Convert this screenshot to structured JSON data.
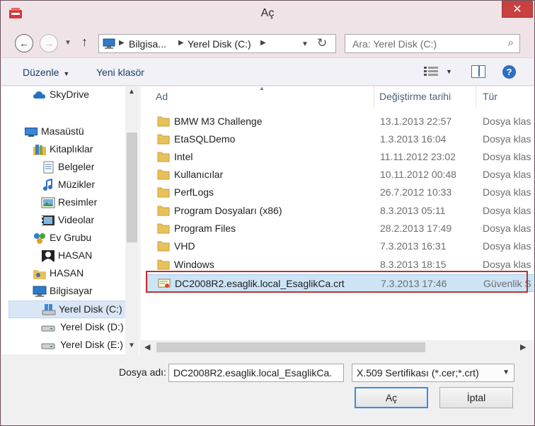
{
  "window": {
    "title": "Aç",
    "close_label": "✕"
  },
  "nav": {
    "address_segments": [
      "Bilgisa...",
      "Yerel Disk (C:)"
    ],
    "search_placeholder": "Ara: Yerel Disk (C:)"
  },
  "toolbar": {
    "organize_label": "Düzenle",
    "new_folder_label": "Yeni klasör"
  },
  "navpane": {
    "items": [
      {
        "label": "SkyDrive",
        "icon": "cloud-icon"
      },
      {
        "label": "Masaüstü",
        "icon": "desktop-icon"
      },
      {
        "label": "Kitaplıklar",
        "icon": "libraries-icon"
      },
      {
        "label": "Belgeler",
        "icon": "documents-icon"
      },
      {
        "label": "Müzikler",
        "icon": "music-icon"
      },
      {
        "label": "Resimler",
        "icon": "pictures-icon"
      },
      {
        "label": "Videolar",
        "icon": "videos-icon"
      },
      {
        "label": "Ev Grubu",
        "icon": "homegroup-icon"
      },
      {
        "label": "HASAN",
        "icon": "user-icon"
      },
      {
        "label": "HASAN",
        "icon": "user-folder-icon"
      },
      {
        "label": "Bilgisayar",
        "icon": "computer-icon"
      },
      {
        "label": "Yerel Disk (C:)",
        "icon": "system-drive-icon",
        "selected": true
      },
      {
        "label": "Yerel Disk (D:)",
        "icon": "drive-icon"
      },
      {
        "label": "Yerel Disk (E:)",
        "icon": "drive-icon"
      }
    ]
  },
  "filelist": {
    "columns": [
      "Ad",
      "Değiştirme tarihi",
      "Tür"
    ],
    "rows": [
      {
        "name": "BMW M3 Challenge",
        "date": "13.1.2013 22:57",
        "type": "Dosya klas",
        "icon": "folder-icon"
      },
      {
        "name": "EtaSQLDemo",
        "date": "1.3.2013 16:04",
        "type": "Dosya klas",
        "icon": "folder-icon"
      },
      {
        "name": "Intel",
        "date": "11.11.2012 23:02",
        "type": "Dosya klas",
        "icon": "folder-icon"
      },
      {
        "name": "Kullanıcılar",
        "date": "10.11.2012 00:48",
        "type": "Dosya klas",
        "icon": "folder-icon"
      },
      {
        "name": "PerfLogs",
        "date": "26.7.2012 10:33",
        "type": "Dosya klas",
        "icon": "folder-icon"
      },
      {
        "name": "Program Dosyaları (x86)",
        "date": "8.3.2013 05:11",
        "type": "Dosya klas",
        "icon": "folder-icon"
      },
      {
        "name": "Program Files",
        "date": "28.2.2013 17:49",
        "type": "Dosya klas",
        "icon": "folder-icon"
      },
      {
        "name": "VHD",
        "date": "7.3.2013 16:31",
        "type": "Dosya klas",
        "icon": "folder-icon"
      },
      {
        "name": "Windows",
        "date": "8.3.2013 18:15",
        "type": "Dosya klas",
        "icon": "folder-icon"
      },
      {
        "name": "DC2008R2.esaglik.local_EsaglikCa.crt",
        "date": "7.3.2013 17:46",
        "type": "Güvenlik S",
        "icon": "certificate-icon",
        "selected": true
      }
    ]
  },
  "bottom": {
    "filename_label": "Dosya adı:",
    "filename_value": "DC2008R2.esaglik.local_EsaglikCa.",
    "filter_value": "X.509 Sertifikası (*.cer;*.crt)",
    "open_label": "Aç",
    "cancel_label": "İptal"
  },
  "colors": {
    "title_bar": "#f0e3e8",
    "close_button": "#c84040",
    "selection": "#cde4f7",
    "highlight_box": "#c0302e",
    "folder": "#e8c15a"
  }
}
